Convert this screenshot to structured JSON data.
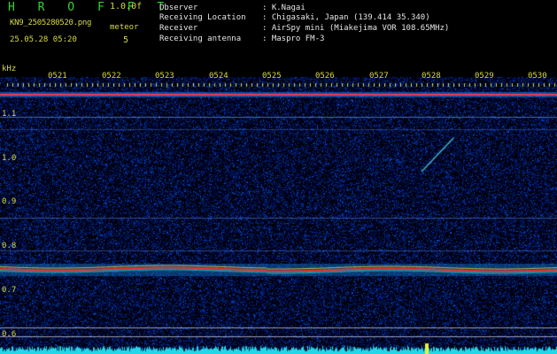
{
  "header": {
    "brand": "H R O F F T",
    "version": "1.0.0f",
    "filename": "KN9_2505280520.png",
    "datetime": "25.05.28 05:20",
    "meteor_label": "meteor",
    "meteor_count": "5"
  },
  "info": {
    "observer_key": "Observer",
    "observer_val": ": K.Nagai",
    "location_key": "Receiving Location",
    "location_val": ": Chigasaki, Japan (139.414 35.340)",
    "receiver_key": "Receiver",
    "receiver_val": ": AirSpy mini (Miakejima VOR 108.65MHz)",
    "antenna_key": "Receiving antenna",
    "antenna_val": ": Maspro FM-3"
  },
  "axis": {
    "unit": "kHz",
    "time_ticks": [
      "0521",
      "0522",
      "0523",
      "0524",
      "0525",
      "0526",
      "0527",
      "0528",
      "0529",
      "0530"
    ],
    "freq_ticks": [
      "1.1",
      "1.0",
      "0.9",
      "0.8",
      "0.7",
      "0.6"
    ]
  },
  "colors": {
    "background": "#000000",
    "text_yellow": "#d8d84a",
    "text_green": "#2fd62f",
    "text_white": "#e6e6e6",
    "noise": "#1020a0",
    "carrier": "#ff3030"
  }
}
